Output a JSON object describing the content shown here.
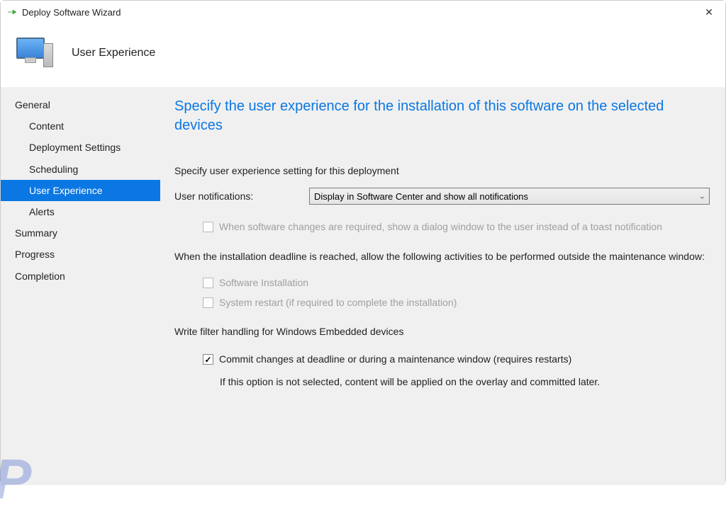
{
  "window": {
    "title": "Deploy Software Wizard"
  },
  "header": {
    "page_title": "User Experience"
  },
  "sidebar": {
    "items": [
      {
        "label": "General",
        "indent": false,
        "selected": false
      },
      {
        "label": "Content",
        "indent": true,
        "selected": false
      },
      {
        "label": "Deployment Settings",
        "indent": true,
        "selected": false
      },
      {
        "label": "Scheduling",
        "indent": true,
        "selected": false
      },
      {
        "label": "User Experience",
        "indent": true,
        "selected": true
      },
      {
        "label": "Alerts",
        "indent": true,
        "selected": false
      },
      {
        "label": "Summary",
        "indent": false,
        "selected": false
      },
      {
        "label": "Progress",
        "indent": false,
        "selected": false
      },
      {
        "label": "Completion",
        "indent": false,
        "selected": false
      }
    ]
  },
  "main": {
    "heading": "Specify the user experience for the installation of this software on the selected devices",
    "subheading": "Specify user experience setting for this deployment",
    "notifications_label": "User notifications:",
    "notifications_value": "Display in Software Center and show all notifications",
    "dialog_checkbox_label": "When software changes are required, show a dialog window to the user instead of a toast notification",
    "deadline_text": "When the installation deadline is reached, allow the following activities to be performed outside the maintenance window:",
    "software_install_label": "Software Installation",
    "system_restart_label": "System restart  (if required to complete the installation)",
    "write_filter_heading": "Write filter handling for Windows Embedded devices",
    "commit_label": "Commit changes at deadline or during a maintenance window (requires restarts)",
    "commit_note": "If this option is not selected, content will be applied on the overlay and committed later."
  }
}
